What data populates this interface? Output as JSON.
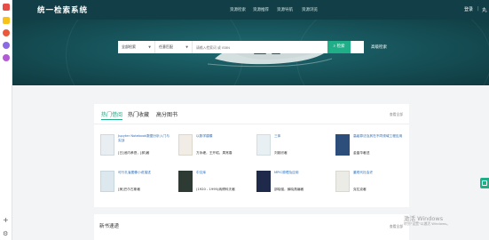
{
  "header": {
    "logo": "统一检索系统",
    "nav": [
      "资源检索",
      "资源推荐",
      "资源导航",
      "资源浏览"
    ],
    "login": "登录",
    "separator": "|",
    "lang": "丸",
    "help_icon": "question-icon"
  },
  "search": {
    "scope_select": "全部检索",
    "field_select": "任意匹配",
    "placeholder": "请输入检索词 或 ISBN",
    "button_label": "检索",
    "advanced": "高级检索"
  },
  "books_panel": {
    "tabs": [
      "热门借阅",
      "热门收藏",
      "高分图书"
    ],
    "active_tab": 0,
    "more": "查看全部",
    "books": [
      {
        "title": "Jupyter Notebook数据分析入门与实战",
        "author": "[日]池内孝啓，[郝]著",
        "cover_color": "#e8eef2"
      },
      {
        "title": "以数学建模",
        "author": "方永峰，王开昭，周常春",
        "cover_color": "#f1ece6"
      },
      {
        "title": "三体",
        "author": "刘慈欣著",
        "cover_color": "#e9f0f3"
      },
      {
        "title": "高级算法及其在不同领域工程应用",
        "author": "金晶华著述",
        "cover_color": "#2d4d7a"
      },
      {
        "title": "可行孔雀图像小说描述",
        "author": "[美]巴尔古斯著",
        "cover_color": "#dde8ee"
      },
      {
        "title": "中文库",
        "author": "(1920 - 1995)纳博科夫著",
        "cover_color": "#2e3b35"
      },
      {
        "title": "MPIC原理及应用",
        "author": "邵晓骏，薛晓燕编著",
        "cover_color": "#1f2a4a"
      },
      {
        "title": "重现代社会史",
        "author": "克拉克著",
        "cover_color": "#ecece6"
      }
    ]
  },
  "new_books": {
    "title": "新书速递",
    "more": "查看全部"
  },
  "watermark": {
    "line1": "激活 Windows",
    "line2": "转到\"设置\"以激活 Windows。"
  },
  "dock": {
    "apps": [
      "#f9c21b",
      "#e94d45",
      "#8b6be3",
      "#1f9fe8",
      "#7c5cd6"
    ],
    "plus_icon": "plus-icon",
    "settings_icon": "gear-icon"
  },
  "colors": {
    "header": "#123f47",
    "accent": "#1fae87",
    "link": "#2a6bb5"
  }
}
